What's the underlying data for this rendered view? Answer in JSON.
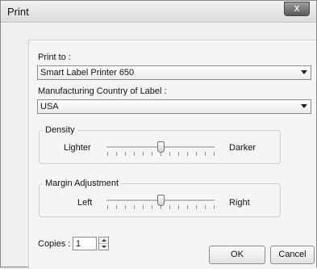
{
  "window": {
    "title": "Print",
    "close_glyph": "x"
  },
  "print_to": {
    "label": "Print to :",
    "selected": "Smart Label Printer 650"
  },
  "country": {
    "label": "Manufacturing Country of Label :",
    "selected": "USA"
  },
  "density": {
    "title": "Density",
    "min_label": "Lighter",
    "max_label": "Darker",
    "level": 0.5
  },
  "margin": {
    "title": "Margin Adjustment",
    "min_label": "Left",
    "max_label": "Right",
    "level": 0.5
  },
  "copies": {
    "label": "Copies :",
    "value": "1"
  },
  "buttons": {
    "ok": "OK",
    "cancel": "Cancel"
  }
}
